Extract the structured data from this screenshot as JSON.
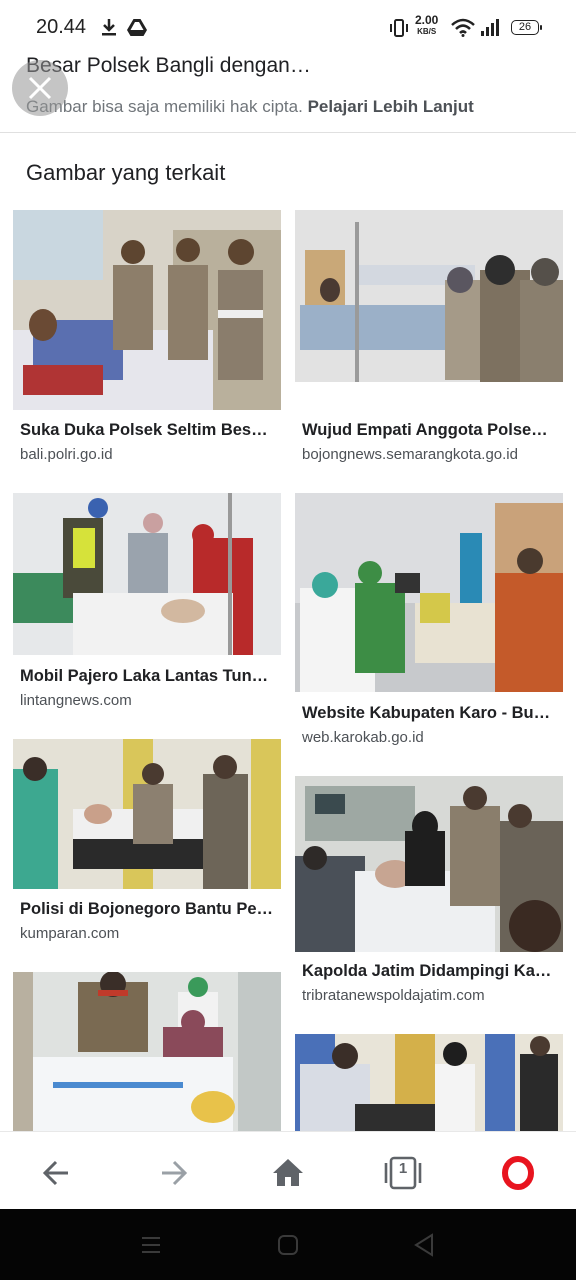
{
  "status_bar": {
    "time": "20.44",
    "net_speed": "2.00",
    "net_unit": "KB/S",
    "battery": "26"
  },
  "viewer": {
    "title": "Besar Polsek Bangli dengan…",
    "copyright_text": "Gambar bisa saja memiliki hak cipta.",
    "learn_more": "Pelajari Lebih Lanjut"
  },
  "related": {
    "heading": "Gambar yang terkait",
    "items": [
      {
        "title": "Suka Duka Polsek Seltim Bes…",
        "source": "bali.polri.go.id"
      },
      {
        "title": "Wujud Empati Anggota Polse…",
        "source": "bojongnews.semarangkota.go.id"
      },
      {
        "title": "Mobil Pajero Laka Lantas Tun…",
        "source": "lintangnews.com"
      },
      {
        "title": "Website Kabupaten Karo - Bu…",
        "source": "web.karokab.go.id"
      },
      {
        "title": "Polisi di Bojonegoro Bantu Pe…",
        "source": "kumparan.com"
      },
      {
        "title": "Kapolda Jatim Didampingi Ka…",
        "source": "tribratanewspoldajatim.com"
      }
    ]
  },
  "toolbar": {
    "tab_count": "1"
  },
  "colors": {
    "opera_red": "#e8141f",
    "icon_gray": "#5f6368",
    "disabled_gray": "#9aa0a6",
    "text_secondary": "#70757a"
  }
}
